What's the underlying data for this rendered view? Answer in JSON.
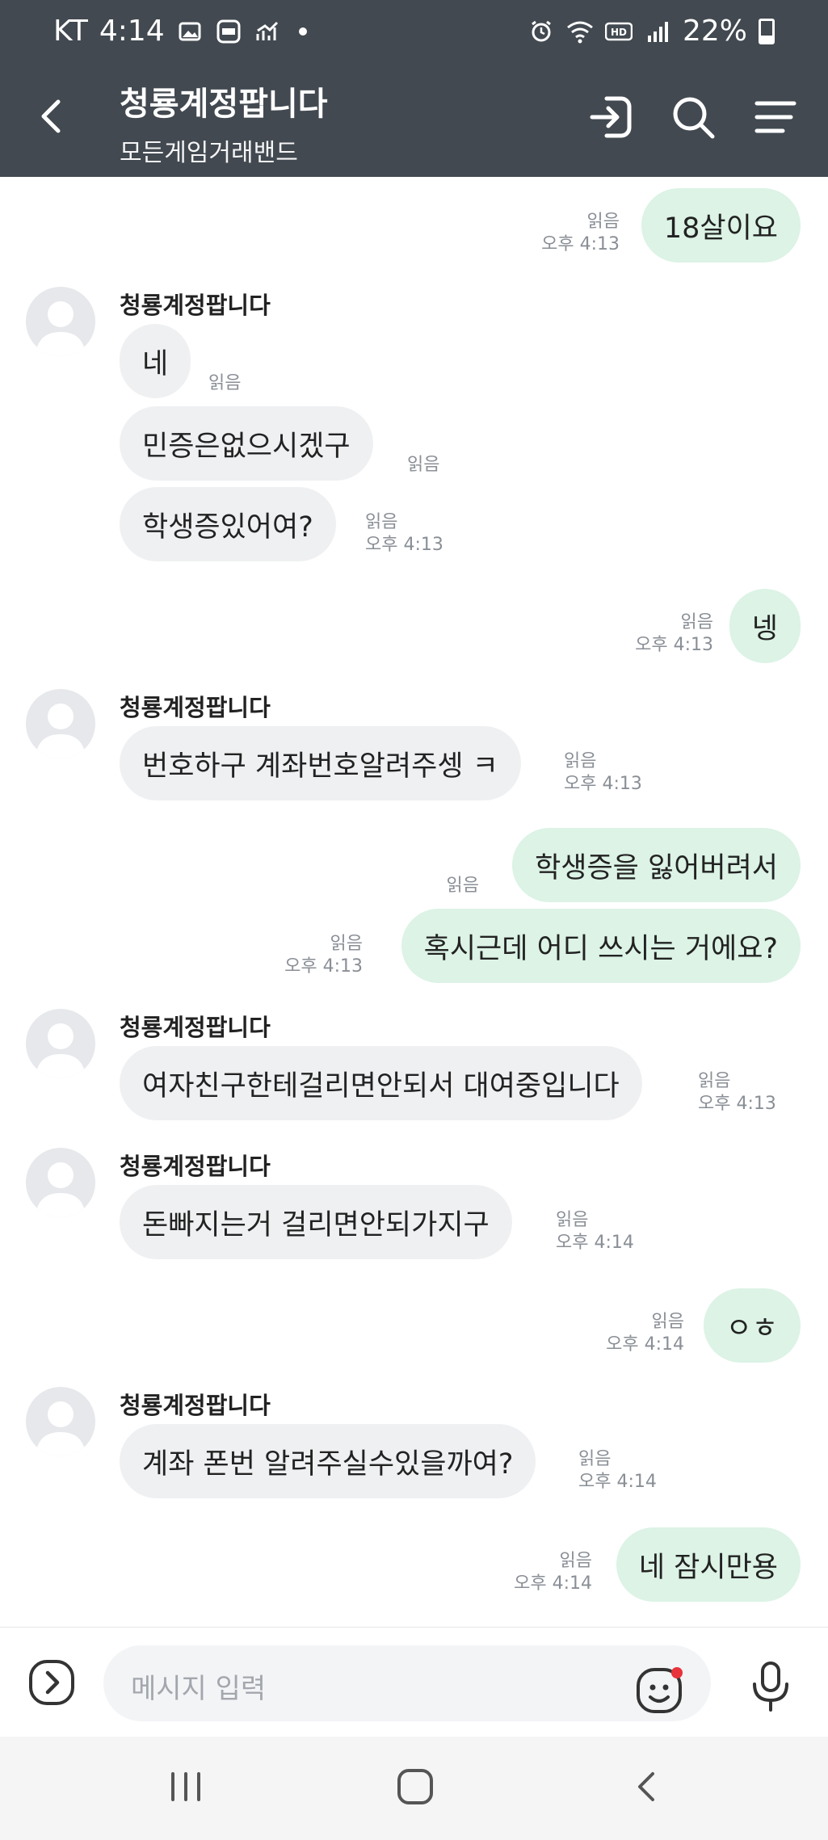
{
  "status_bar": {
    "carrier": "KT",
    "time": "4:14",
    "battery": "22%"
  },
  "header": {
    "title": "청룡계정팝니다",
    "subtitle": "모든게임거래밴드"
  },
  "chat": {
    "m1": {
      "text": "18살이요",
      "read": "읽음",
      "time": "오후 4:13"
    },
    "g1": {
      "sender": "청룡계정팝니다",
      "b1": {
        "text": "네",
        "read": "읽음"
      },
      "b2": {
        "text": "민증은없으시겠구",
        "read": "읽음"
      },
      "b3": {
        "text": "학생증있어여?",
        "read": "읽음",
        "time": "오후 4:13"
      }
    },
    "m2": {
      "text": "넹",
      "read": "읽음",
      "time": "오후 4:13"
    },
    "g2": {
      "sender": "청룡계정팝니다",
      "b1": {
        "text": "번호하구 계좌번호알려주셍 ㅋ",
        "read": "읽음",
        "time": "오후 4:13"
      }
    },
    "m3": {
      "text": "학생증을 잃어버려서",
      "read": "읽음"
    },
    "m4": {
      "text": "혹시근데 어디 쓰시는 거에요?",
      "read": "읽음",
      "time": "오후 4:13"
    },
    "g3": {
      "sender": "청룡계정팝니다",
      "b1": {
        "text": "여자친구한테걸리면안되서 대여중입니다",
        "read": "읽음",
        "time": "오후 4:13"
      }
    },
    "g4": {
      "sender": "청룡계정팝니다",
      "b1": {
        "text": "돈빠지는거 걸리면안되가지구",
        "read": "읽음",
        "time": "오후 4:14"
      }
    },
    "m5": {
      "text": "ㅇㅎ",
      "read": "읽음",
      "time": "오후 4:14"
    },
    "g5": {
      "sender": "청룡계정팝니다",
      "b1": {
        "text": "계좌 폰번 알려주실수있을까여?",
        "read": "읽음",
        "time": "오후 4:14"
      }
    },
    "m6": {
      "text": "네 잠시만용",
      "read": "읽음",
      "time": "오후 4:14"
    }
  },
  "input": {
    "placeholder": "메시지 입력"
  },
  "colors": {
    "header_bg": "#424950",
    "bubble_out": "#dcf3e6",
    "bubble_in": "#eff0f2",
    "notification_dot": "#e8323c"
  }
}
